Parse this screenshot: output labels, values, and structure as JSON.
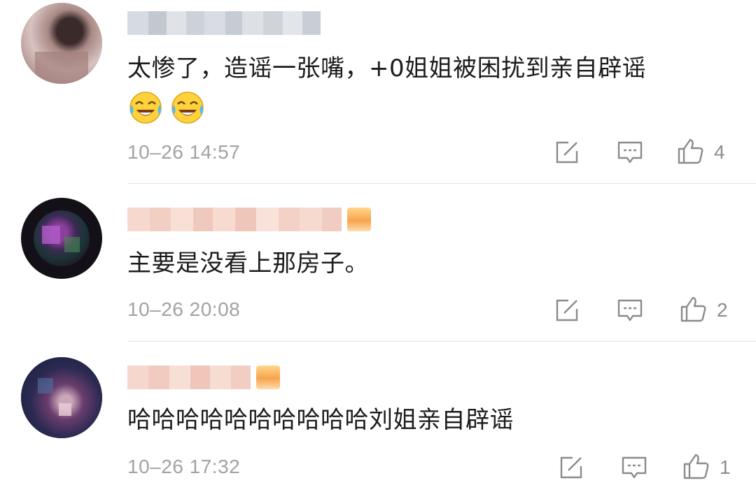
{
  "comments": [
    {
      "text": "太惨了，造谣一张嘴，+0姐姐被困扰到亲自辟谣",
      "emojis": [
        "crying-laughing-emoji",
        "crying-laughing-emoji"
      ],
      "time": "10–26 14:57",
      "likes": "4"
    },
    {
      "text": "主要是没看上那房子。",
      "time": "10–26 20:08",
      "likes": "2"
    },
    {
      "text": "哈哈哈哈哈哈哈哈哈哈刘姐亲自辟谣",
      "time": "10–26 17:32",
      "likes": "1"
    }
  ],
  "icons": {
    "share": "share-edit-icon",
    "reply": "comment-icon",
    "like": "thumbs-up-icon"
  },
  "colors": {
    "timestamp": "#a2a2a2",
    "icon": "#8a8a8a",
    "divider": "#e3e3e3",
    "text": "#1b1b1b"
  }
}
